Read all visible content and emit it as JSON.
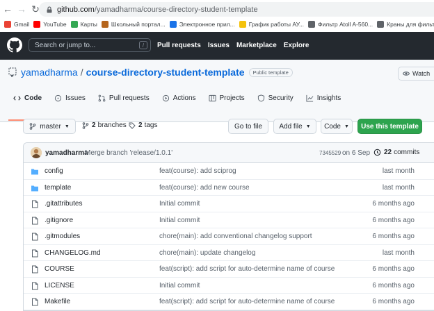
{
  "browser": {
    "url_host": "github.com",
    "url_path": "/yamadharma/course-directory-student-template",
    "bookmarks": [
      {
        "label": "Gmail",
        "icon": "gmail-icon",
        "color": "#ea4335"
      },
      {
        "label": "YouTube",
        "icon": "youtube-icon",
        "color": "#ff0000"
      },
      {
        "label": "Карты",
        "icon": "maps-icon",
        "color": "#34a853"
      },
      {
        "label": "Школьный портал...",
        "icon": "school-portal-icon",
        "color": "#b5651d"
      },
      {
        "label": "Электронное прил...",
        "icon": "app-icon",
        "color": "#1a73e8"
      },
      {
        "label": "График работы АУ...",
        "icon": "schedule-icon",
        "color": "#f4c20d"
      },
      {
        "label": "Фильтр Atoll A-560...",
        "icon": "globe-icon",
        "color": "#5f6368"
      },
      {
        "label": "Краны для фильтр...",
        "icon": "globe-icon",
        "color": "#5f6368"
      }
    ]
  },
  "github": {
    "search_placeholder": "Search or jump to...",
    "search_shortcut": "/",
    "nav": [
      "Pull requests",
      "Issues",
      "Marketplace",
      "Explore"
    ]
  },
  "repo": {
    "owner": "yamadharma",
    "separator": "/",
    "name": "course-directory-student-template",
    "badge": "Public template",
    "watch_label": "Watch",
    "tabs": [
      {
        "label": "Code",
        "icon": "code-icon",
        "active": true
      },
      {
        "label": "Issues",
        "icon": "issue-icon",
        "active": false
      },
      {
        "label": "Pull requests",
        "icon": "pull-request-icon",
        "active": false
      },
      {
        "label": "Actions",
        "icon": "actions-icon",
        "active": false
      },
      {
        "label": "Projects",
        "icon": "projects-icon",
        "active": false
      },
      {
        "label": "Security",
        "icon": "shield-icon",
        "active": false
      },
      {
        "label": "Insights",
        "icon": "graph-icon",
        "active": false
      }
    ]
  },
  "toolbar": {
    "branch": "master",
    "branches_count": "2",
    "branches_label": "branches",
    "tags_count": "2",
    "tags_label": "tags",
    "goto_file": "Go to file",
    "add_file": "Add file",
    "code": "Code",
    "use_template": "Use this template"
  },
  "commit": {
    "author": "yamadharma",
    "message": "Merge branch 'release/1.0.1'",
    "sha": "7345529",
    "date": "on 6 Sep",
    "commits_count": "22",
    "commits_label": "commits"
  },
  "files": [
    {
      "name": "config",
      "type": "dir",
      "message": "feat(course): add sciprog",
      "age": "last month"
    },
    {
      "name": "template",
      "type": "dir",
      "message": "feat(course): add new course",
      "age": "last month"
    },
    {
      "name": ".gitattributes",
      "type": "file",
      "message": "Initial commit",
      "age": "6 months ago"
    },
    {
      "name": ".gitignore",
      "type": "file",
      "message": "Initial commit",
      "age": "6 months ago"
    },
    {
      "name": ".gitmodules",
      "type": "file",
      "message": "chore(main): add conventional changelog support",
      "age": "6 months ago"
    },
    {
      "name": "CHANGELOG.md",
      "type": "file",
      "message": "chore(main): update changelog",
      "age": "last month"
    },
    {
      "name": "COURSE",
      "type": "file",
      "message": "feat(script): add script for auto-determine name of course",
      "age": "6 months ago"
    },
    {
      "name": "LICENSE",
      "type": "file",
      "message": "Initial commit",
      "age": "6 months ago"
    },
    {
      "name": "Makefile",
      "type": "file",
      "message": "feat(script): add script for auto-determine name of course",
      "age": "6 months ago"
    }
  ],
  "colors": {
    "header_bg": "#24292f",
    "link": "#0969da",
    "green": "#2da44e",
    "folder": "#54aeff",
    "tab_underline": "#fd8c73"
  }
}
